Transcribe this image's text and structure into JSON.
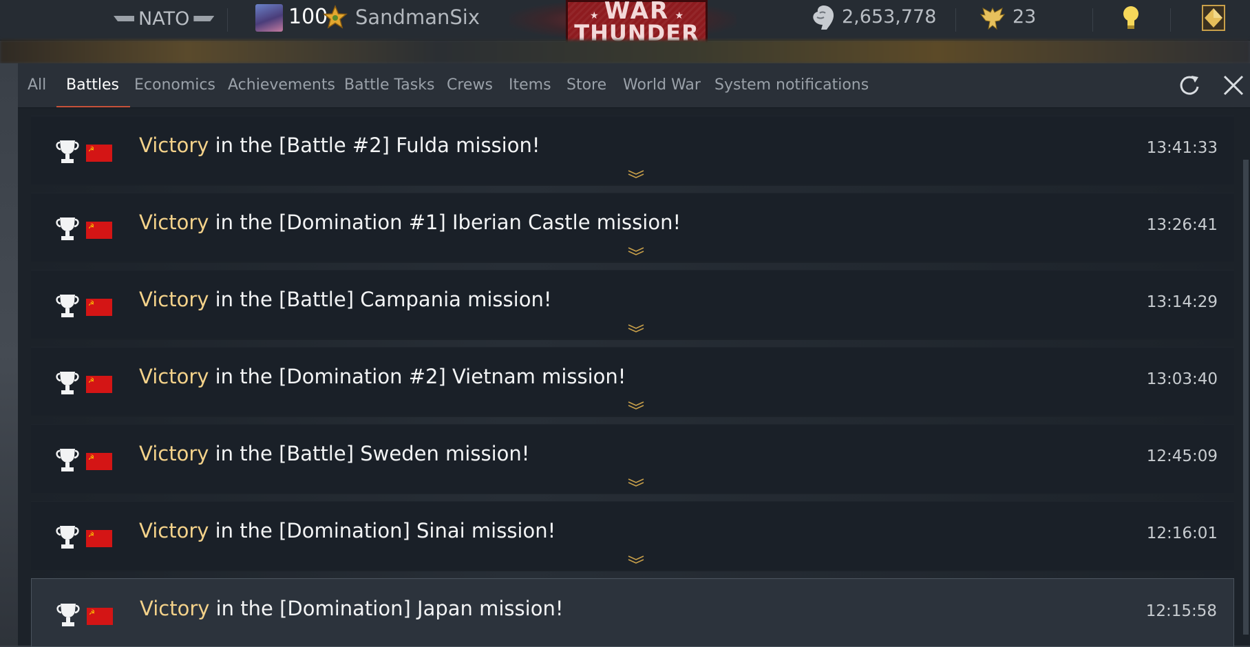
{
  "topbar": {
    "country": "NATO",
    "rank": "100",
    "username": "SandmanSix",
    "logo_line1": "WAR",
    "logo_line2": "THUNDER",
    "silver_lions": "2,653,778",
    "golden_eagles": "23"
  },
  "tabs": [
    {
      "label": "All"
    },
    {
      "label": "Battles",
      "active": true
    },
    {
      "label": "Economics"
    },
    {
      "label": "Achievements"
    },
    {
      "label": "Battle Tasks"
    },
    {
      "label": "Crews"
    },
    {
      "label": "Items"
    },
    {
      "label": "Store"
    },
    {
      "label": "World War"
    },
    {
      "label": "System notifications"
    }
  ],
  "notifications": [
    {
      "highlight": "Victory",
      "text": " in the [Battle #2] Fulda mission!",
      "time": "13:41:33"
    },
    {
      "highlight": "Victory",
      "text": " in the [Domination #1] Iberian Castle mission!",
      "time": "13:26:41"
    },
    {
      "highlight": "Victory",
      "text": " in the [Battle] Campania mission!",
      "time": "13:14:29"
    },
    {
      "highlight": "Victory",
      "text": " in the [Domination #2] Vietnam mission!",
      "time": "13:03:40"
    },
    {
      "highlight": "Victory",
      "text": " in the [Battle] Sweden mission!",
      "time": "12:45:09"
    },
    {
      "highlight": "Victory",
      "text": " in the [Domination] Sinai mission!",
      "time": "12:16:01"
    },
    {
      "highlight": "Victory",
      "text": " in the [Domination] Japan mission!",
      "time": "12:15:58",
      "selected": true
    }
  ],
  "icons": {
    "trophy": "trophy-icon",
    "flag": "ussr-flag-icon",
    "expand": "chevron-down-icon",
    "refresh": "refresh-icon",
    "close": "close-icon"
  },
  "colors": {
    "victory": "#f4d28a",
    "active_tab_underline": "#c8523a",
    "flag_red": "#d41515"
  }
}
